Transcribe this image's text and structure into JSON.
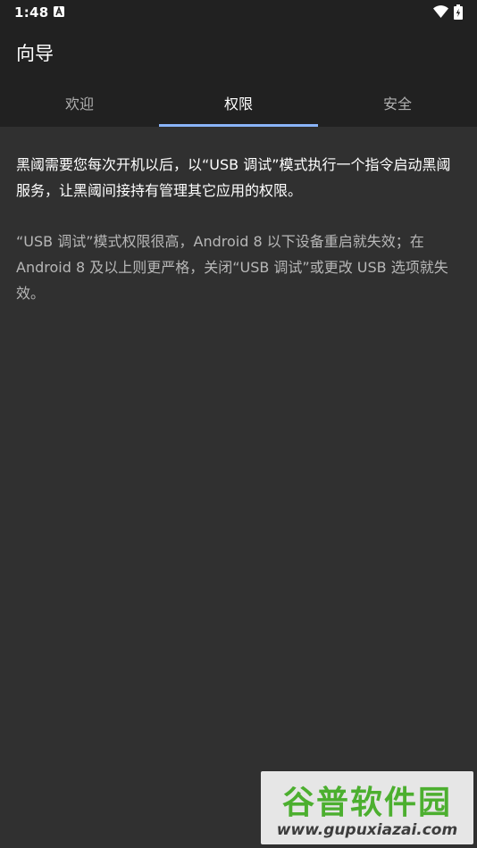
{
  "status_bar": {
    "time": "1:48",
    "icons": [
      "a-notification-icon",
      "wifi-icon",
      "battery-charging-icon"
    ]
  },
  "app_bar": {
    "title": "向导"
  },
  "tabs": [
    {
      "label": "欢迎",
      "active": false
    },
    {
      "label": "权限",
      "active": true
    },
    {
      "label": "安全",
      "active": false
    }
  ],
  "content": {
    "main_text": "黑阈需要您每次开机以后，以“USB 调试”模式执行一个指令启动黑阈服务，让黑阈间接持有管理其它应用的权限。",
    "secondary_text": "“USB 调试”模式权限很高，Android 8 以下设备重启就失效；在 Android 8 及以上则更严格，关闭“USB 调试”或更改 USB 选项就失效。"
  },
  "watermark": {
    "title": "谷普软件园",
    "url": "www.gupuxiazai.com"
  },
  "colors": {
    "background": "#303030",
    "app_bar": "#212121",
    "tab_indicator": "#8ab4f8",
    "watermark_green": "#4caf2f"
  }
}
